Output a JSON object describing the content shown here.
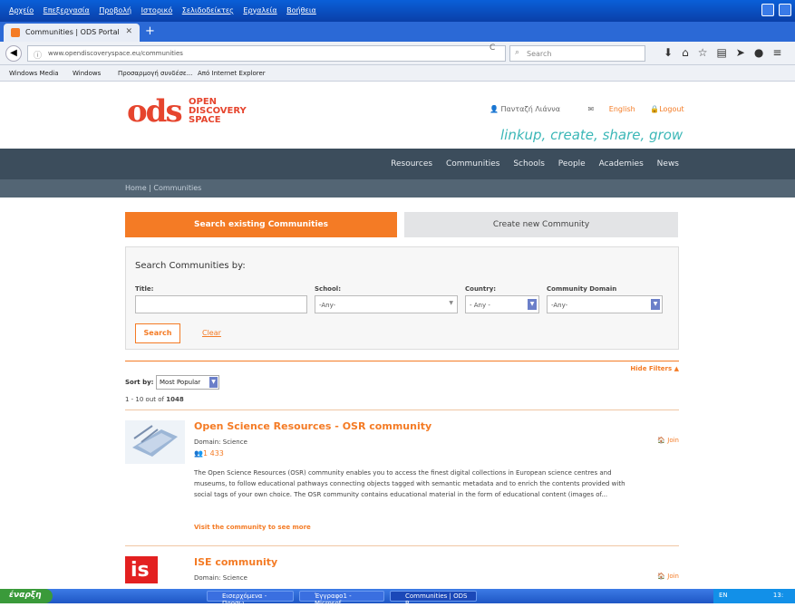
{
  "window": {
    "menu": [
      "Αρχείο",
      "Επεξεργασία",
      "Προβολή",
      "Ιστορικό",
      "Σελιδοδείκτες",
      "Εργαλεία",
      "Βοήθεια"
    ]
  },
  "browser": {
    "tab_title": "Communities | ODS Portal",
    "url": "www.opendiscoveryspace.eu/communities",
    "search_placeholder": "Search",
    "bookmarks": [
      "Windows Media",
      "Windows",
      "Προσαρμογή συνδέσε...",
      "Από Internet Explorer"
    ]
  },
  "site": {
    "logo_letters": "ods",
    "logo_text": [
      "OPEN",
      "DISCOVERY",
      "SPACE"
    ],
    "user_name": "Πανταζή Λιάννα",
    "language": "English",
    "logout": "Logout",
    "tagline": "linkup, create, share, grow",
    "nav": [
      "Resources",
      "Communities",
      "Schools",
      "People",
      "Academies",
      "News"
    ],
    "breadcrumb": "Home | Communities"
  },
  "page": {
    "tab_search": "Search existing Communities",
    "tab_create": "Create new Community",
    "filters": {
      "heading": "Search Communities by:",
      "title_label": "Title:",
      "title_value": "",
      "school_label": "School:",
      "school_value": "-Any-",
      "country_label": "Country:",
      "country_value": "- Any -",
      "domain_label": "Community Domain",
      "domain_value": "-Any-",
      "search_button": "Search",
      "clear_link": "Clear"
    },
    "hide_filters": "Hide Filters",
    "sort_label": "Sort by:",
    "sort_value": "Most Popular",
    "count_prefix": "1 - 10 out of",
    "count_total": "1048"
  },
  "communities": [
    {
      "title": "Open Science Resources - OSR community",
      "domain": "Domain: Science",
      "members": "1 433",
      "join": "Join",
      "description": "The Open Science Resources (OSR) community enables you to access the finest digital collections in European science centres and museums, to follow educational pathways connecting objects tagged with semantic metadata and to enrich the contents provided with social tags of your own choice. The OSR community contains educational material in the form of educational content (images of...",
      "visit": "Visit the community to see more"
    },
    {
      "title": "ISE community",
      "domain": "Domain: Science",
      "join": "Join",
      "thumb_text": "is"
    }
  ],
  "taskbar": {
    "start": "έναρξη",
    "items": [
      "Εισερχόμενα - Προσω...",
      "Έγγραφο1 - Microsof...",
      "Communities | ODS P..."
    ],
    "tray_lang": "EN",
    "clock": "13:"
  },
  "colors": {
    "accent": "#f47b25",
    "nav": "#3c4d5c",
    "tagline": "#3bb7b7"
  }
}
